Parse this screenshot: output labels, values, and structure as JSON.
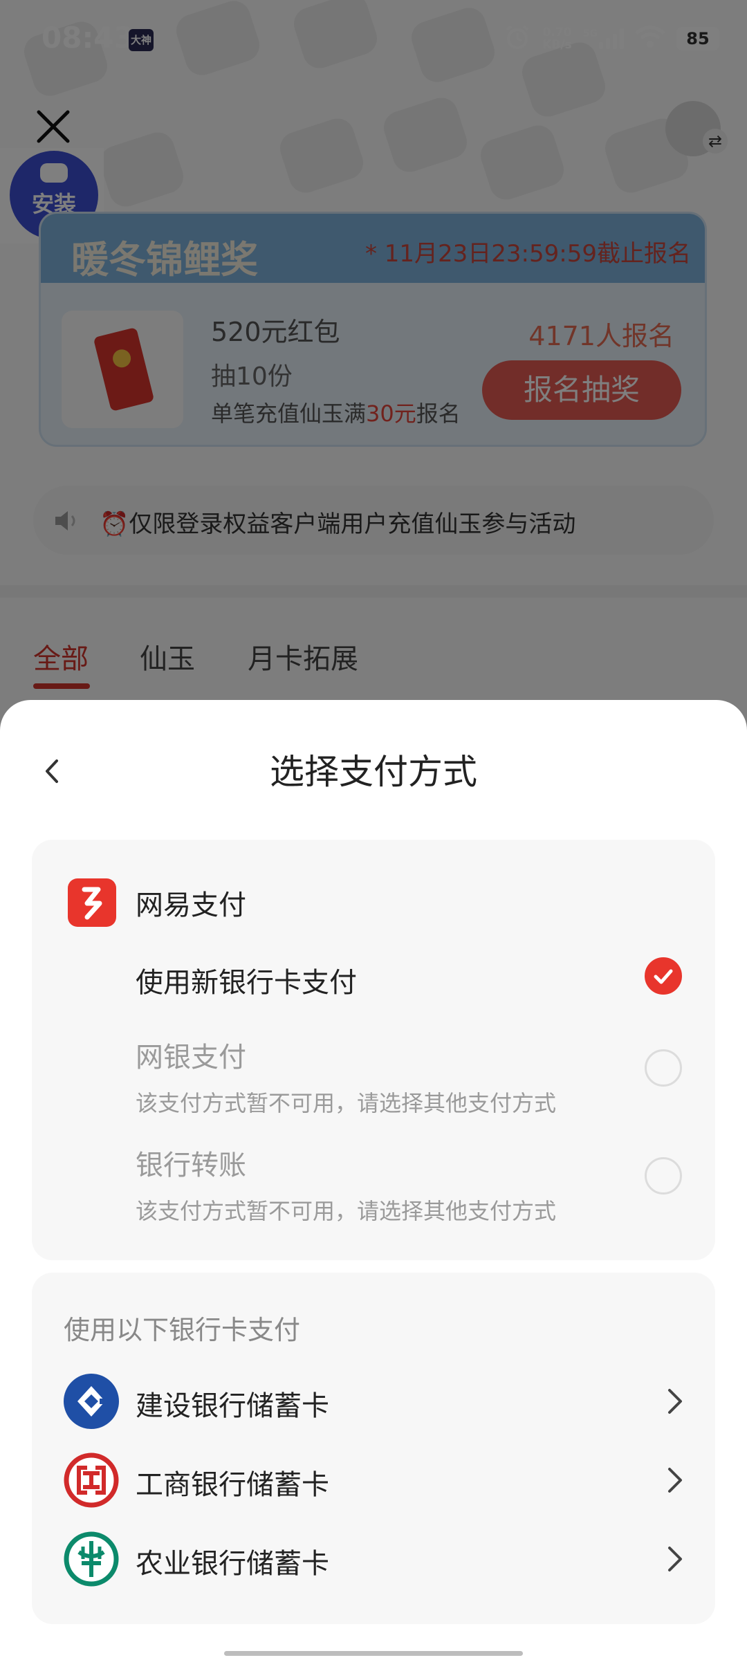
{
  "status_bar": {
    "time": "08:43",
    "app_badge": "大神",
    "net_speed_value": "0.70",
    "net_speed_unit": "KB/s",
    "signal_type": "5G",
    "battery": "85"
  },
  "page": {
    "install_label": "安装",
    "banner": {
      "title": "暖冬锦鲤奖",
      "deadline": "* 11月23日23:59:59截止报名",
      "prize_name": "520元红包",
      "prize_quantity": "抽10份",
      "condition_prefix": "单笔充值仙玉满",
      "condition_amount": "30元",
      "condition_suffix": "报名",
      "enroll_count": "4171人报名",
      "enroll_button": "报名抽奖",
      "packet_text": "520元"
    },
    "notice": "⏰仅限登录权益客户端用户充值仙玉参与活动",
    "tabs": [
      "全部",
      "仙玉",
      "月卡拓展"
    ]
  },
  "payment_sheet": {
    "title": "选择支付方式",
    "provider": "网易支付",
    "options": [
      {
        "label": "使用新银行卡支付",
        "note": "",
        "selected": true,
        "enabled": true
      },
      {
        "label": "网银支付",
        "note": "该支付方式暂不可用，请选择其他支付方式",
        "selected": false,
        "enabled": false
      },
      {
        "label": "银行转账",
        "note": "该支付方式暂不可用，请选择其他支付方式",
        "selected": false,
        "enabled": false
      }
    ],
    "bank_section_title": "使用以下银行卡支付",
    "banks": [
      {
        "name": "建设银行储蓄卡",
        "logo_icon": "ccb-logo-icon",
        "color": "#1f4fa6"
      },
      {
        "name": "工商银行储蓄卡",
        "logo_icon": "icbc-logo-icon",
        "color": "#d12a2a"
      },
      {
        "name": "农业银行储蓄卡",
        "logo_icon": "abc-logo-icon",
        "color": "#0c8a6b"
      }
    ]
  },
  "colors": {
    "accent_red": "#e8352c",
    "dim_overlay": "rgba(0,0,0,0.5)",
    "install_blue": "#3d4fd3"
  }
}
